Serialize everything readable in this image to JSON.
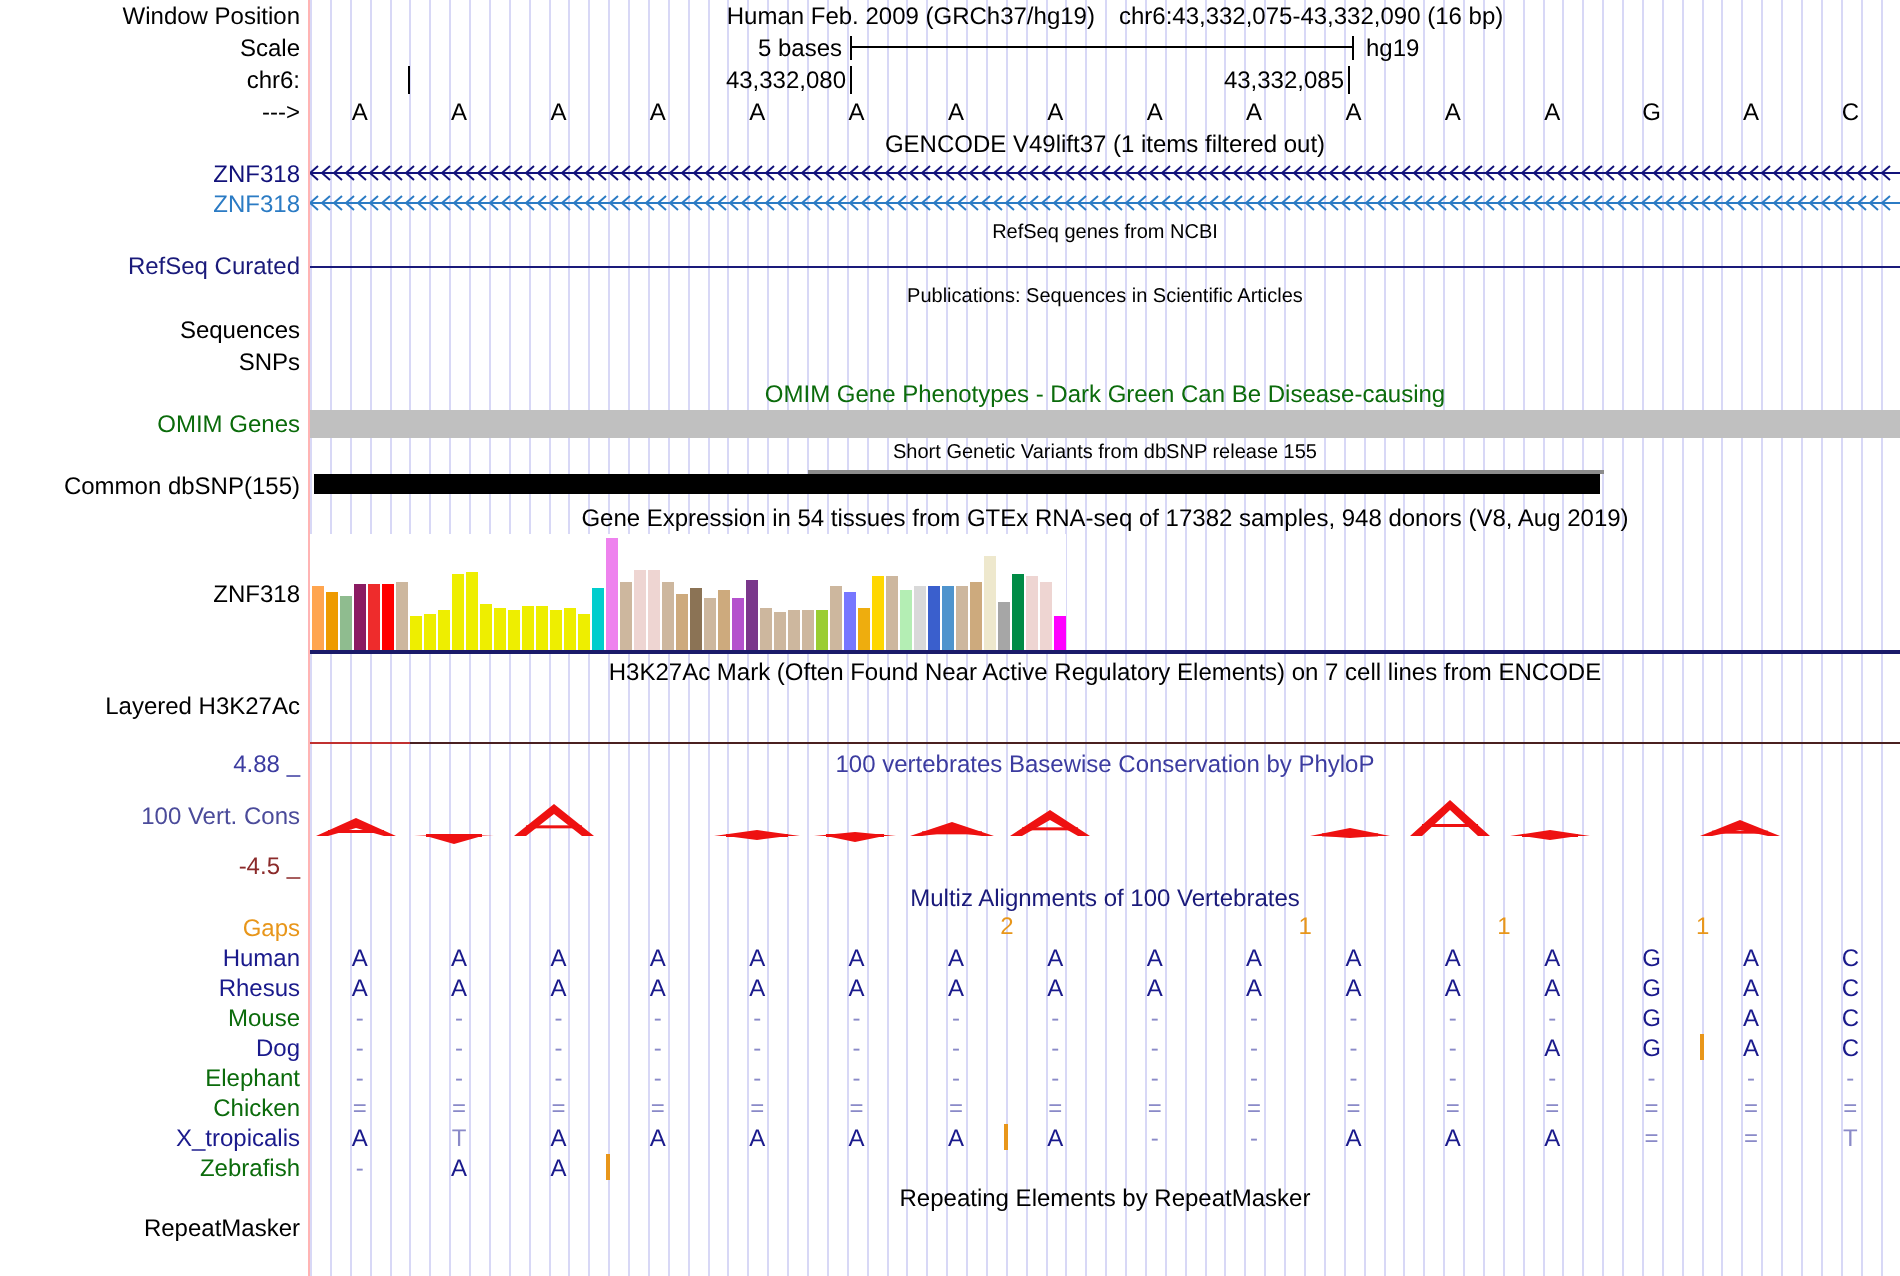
{
  "header": {
    "window_position_label": "Window Position",
    "assembly": "Human Feb. 2009 (GRCh37/hg19)",
    "position": "chr6:43,332,075-43,332,090 (16 bp)",
    "scale_label": "Scale",
    "scale_text": "5 bases",
    "scale_db": "hg19",
    "chrom_label": "chr6:",
    "ticks": [
      "43,332,080",
      "43,332,085"
    ],
    "strand_label": "--->",
    "bases": [
      "A",
      "A",
      "A",
      "A",
      "A",
      "A",
      "A",
      "A",
      "A",
      "A",
      "A",
      "A",
      "A",
      "G",
      "A",
      "C"
    ]
  },
  "gencode": {
    "title": "GENCODE V49lift37 (1 items filtered out)",
    "items": [
      {
        "label": "ZNF318",
        "color": "#12127a"
      },
      {
        "label": "ZNF318",
        "color": "#2b7bc4"
      }
    ]
  },
  "refseq": {
    "title": "RefSeq genes from NCBI",
    "label": "RefSeq Curated"
  },
  "publications": {
    "title": "Publications: Sequences in Scientific Articles",
    "labels": [
      "Sequences",
      "SNPs"
    ]
  },
  "omim": {
    "title": "OMIM Gene Phenotypes - Dark Green Can Be Disease-causing",
    "label": "OMIM Genes"
  },
  "dbsnp": {
    "title": "Short Genetic Variants from dbSNP release 155",
    "label": "Common dbSNP(155)"
  },
  "gtex": {
    "title": "Gene Expression in 54 tissues from GTEx RNA-seq of 17382 samples, 948 donors (V8, Aug 2019)",
    "label": "ZNF318"
  },
  "h3k27ac": {
    "title": "H3K27Ac Mark (Often Found Near Active Regulatory Elements) on 7 cell lines from ENCODE",
    "label": "Layered H3K27Ac"
  },
  "phylop": {
    "title": "100 vertebrates Basewise Conservation by PhyloP",
    "label": "100 Vert. Cons",
    "max_label": "4.88 _",
    "min_label": "-4.5 _"
  },
  "multiz": {
    "title": "Multiz Alignments of 100 Vertebrates",
    "gaps_label": "Gaps",
    "gaps": [
      {
        "kind": "none"
      },
      {
        "kind": "none"
      },
      {
        "kind": "none"
      },
      {
        "kind": "none"
      },
      {
        "kind": "none"
      },
      {
        "kind": "none"
      },
      {
        "kind": "gap",
        "count": "2"
      },
      {
        "kind": "none"
      },
      {
        "kind": "none"
      },
      {
        "kind": "gap",
        "count": "1"
      },
      {
        "kind": "none"
      },
      {
        "kind": "gap",
        "count": "1"
      },
      {
        "kind": "none"
      },
      {
        "kind": "gap",
        "count": "1"
      },
      {
        "kind": "none"
      },
      {
        "kind": "none"
      }
    ],
    "species": [
      {
        "name": "Human",
        "color": "#1a1a8c",
        "bases": [
          "A",
          "A",
          "A",
          "A",
          "A",
          "A",
          "A",
          "A",
          "A",
          "A",
          "A",
          "A",
          "A",
          "G",
          "A",
          "C"
        ],
        "match": [
          true,
          true,
          true,
          true,
          true,
          true,
          true,
          true,
          true,
          true,
          true,
          true,
          true,
          true,
          true,
          true
        ],
        "insertions": [
          false,
          false,
          false,
          false,
          false,
          false,
          false,
          false,
          false,
          false,
          false,
          false,
          false,
          false,
          false,
          false
        ]
      },
      {
        "name": "Rhesus",
        "color": "#1a1a8c",
        "bases": [
          "A",
          "A",
          "A",
          "A",
          "A",
          "A",
          "A",
          "A",
          "A",
          "A",
          "A",
          "A",
          "A",
          "G",
          "A",
          "C"
        ],
        "match": [
          true,
          true,
          true,
          true,
          true,
          true,
          true,
          true,
          true,
          true,
          true,
          true,
          true,
          true,
          true,
          true
        ],
        "insertions": [
          false,
          false,
          false,
          false,
          false,
          false,
          false,
          false,
          false,
          false,
          false,
          false,
          false,
          false,
          false,
          false
        ]
      },
      {
        "name": "Mouse",
        "color": "#0b6b0b",
        "bases": [
          "-",
          "-",
          "-",
          "-",
          "-",
          "-",
          "-",
          "-",
          "-",
          "-",
          "-",
          "-",
          "-",
          "G",
          "A",
          "C"
        ],
        "match": [
          false,
          false,
          false,
          false,
          false,
          false,
          false,
          false,
          false,
          false,
          false,
          false,
          false,
          true,
          true,
          true
        ],
        "insertions": [
          false,
          false,
          false,
          false,
          false,
          false,
          false,
          false,
          false,
          false,
          false,
          false,
          false,
          false,
          false,
          false
        ]
      },
      {
        "name": "Dog",
        "color": "#1a1a8c",
        "bases": [
          "-",
          "-",
          "-",
          "-",
          "-",
          "-",
          "-",
          "-",
          "-",
          "-",
          "-",
          "-",
          "A",
          "G",
          "A",
          "C"
        ],
        "match": [
          false,
          false,
          false,
          false,
          false,
          false,
          false,
          false,
          false,
          false,
          false,
          false,
          true,
          true,
          true,
          true
        ],
        "insertions": [
          false,
          false,
          false,
          false,
          false,
          false,
          false,
          false,
          false,
          false,
          false,
          false,
          false,
          true,
          false,
          false
        ]
      },
      {
        "name": "Elephant",
        "color": "#0b6b0b",
        "bases": [
          "-",
          "-",
          "-",
          "-",
          "-",
          "-",
          "-",
          "-",
          "-",
          "-",
          "-",
          "-",
          "-",
          "-",
          "-",
          "-"
        ],
        "match": [
          false,
          false,
          false,
          false,
          false,
          false,
          false,
          false,
          false,
          false,
          false,
          false,
          false,
          false,
          false,
          false
        ],
        "insertions": [
          false,
          false,
          false,
          false,
          false,
          false,
          false,
          false,
          false,
          false,
          false,
          false,
          false,
          false,
          false,
          false
        ]
      },
      {
        "name": "Chicken",
        "color": "#0b6b0b",
        "bases": [
          "=",
          "=",
          "=",
          "=",
          "=",
          "=",
          "=",
          "=",
          "=",
          "=",
          "=",
          "=",
          "=",
          "=",
          "=",
          "="
        ],
        "match": [
          false,
          false,
          false,
          false,
          false,
          false,
          false,
          false,
          false,
          false,
          false,
          false,
          false,
          false,
          false,
          false
        ],
        "insertions": [
          false,
          false,
          false,
          false,
          false,
          false,
          false,
          false,
          false,
          false,
          false,
          false,
          false,
          false,
          false,
          false
        ]
      },
      {
        "name": "X_tropicalis",
        "color": "#1a1a8c",
        "bases": [
          "A",
          "T",
          "A",
          "A",
          "A",
          "A",
          "A",
          "A",
          "-",
          "-",
          "A",
          "A",
          "A",
          "=",
          "=",
          "T"
        ],
        "match": [
          true,
          false,
          true,
          true,
          true,
          true,
          true,
          true,
          false,
          false,
          true,
          true,
          true,
          false,
          false,
          false
        ],
        "insertions": [
          false,
          false,
          false,
          false,
          false,
          false,
          true,
          false,
          false,
          false,
          false,
          false,
          false,
          false,
          false,
          false
        ]
      },
      {
        "name": "Zebrafish",
        "color": "#0b6b0b",
        "bases": [
          "-",
          "A",
          "A"
        ],
        "match": [
          false,
          true,
          true
        ],
        "insertions": [
          false,
          false,
          true
        ]
      }
    ]
  },
  "repeatmasker": {
    "title": "Repeating Elements by RepeatMasker",
    "label": "RepeatMasker"
  }
}
